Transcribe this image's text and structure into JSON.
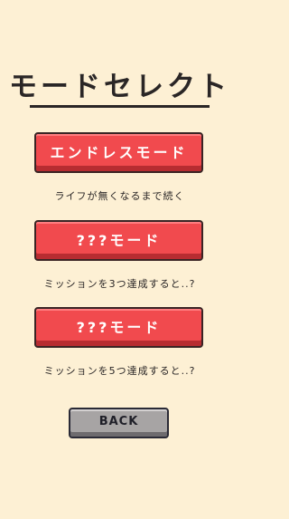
{
  "screen": {
    "title": "モードセレクト"
  },
  "modes": [
    {
      "label": "エンドレスモード",
      "description": "ライフが無くなるまで続く"
    },
    {
      "label": "???モード",
      "description": "ミッションを3つ達成すると..?"
    },
    {
      "label": "???モード",
      "description": "ミッションを5つ達成すると..?"
    }
  ],
  "back": {
    "label": "BACK"
  },
  "colors": {
    "background": "#fdf0d4",
    "button_red": "#f14a4e",
    "button_gray": "#a7a4a4",
    "text_dark": "#2a2626"
  }
}
